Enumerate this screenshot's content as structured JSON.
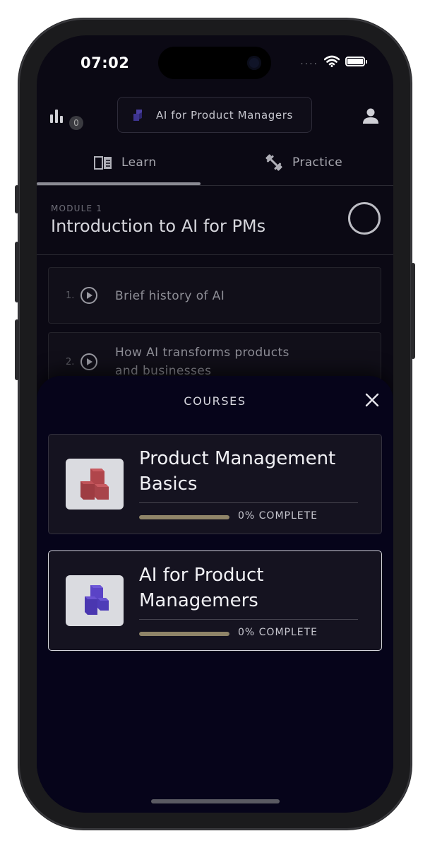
{
  "status_bar": {
    "time": "07:02",
    "signal_dots": "...."
  },
  "header": {
    "stats_badge": "0",
    "current_course": "AI for Product Managers"
  },
  "tabs": [
    {
      "label": "Learn",
      "icon": "book-icon",
      "active": true
    },
    {
      "label": "Practice",
      "icon": "dumbbell-icon",
      "active": false
    }
  ],
  "module": {
    "label": "MODULE 1",
    "title": "Introduction to AI for PMs"
  },
  "lessons": [
    {
      "number": "1.",
      "title": "Brief history of AI"
    },
    {
      "number": "2.",
      "title_line1": "How AI transforms products",
      "title_line2": "and businesses"
    }
  ],
  "courses_sheet": {
    "title": "COURSES",
    "courses": [
      {
        "title_line1": "Product Management",
        "title_line2": "Basics",
        "progress": 0,
        "progress_label": "0% COMPLETE",
        "cube_color": "#b0454b",
        "selected": false
      },
      {
        "title_line1": "AI for Product",
        "title_line2": "Managemers",
        "progress": 0,
        "progress_label": "0% COMPLETE",
        "cube_color": "#5a43c6",
        "selected": true
      }
    ]
  },
  "colors": {
    "background": "#0b0914",
    "sheet": "#06041a",
    "progress_track": "#8f8468"
  }
}
